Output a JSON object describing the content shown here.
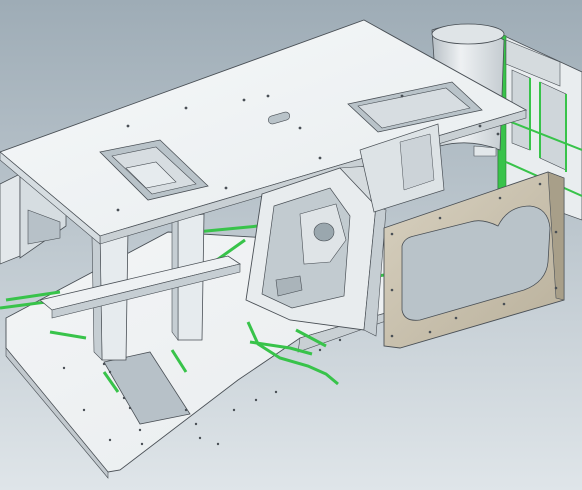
{
  "viewport": {
    "background_top": "#9fadb7",
    "background_bottom": "#d8dfe4"
  },
  "colors": {
    "sheet_metal": "#f2f4f5",
    "sheet_shadow": "#c9d0d4",
    "edge": "#4a5056",
    "accent_green": "#38c34a",
    "panel_tan": "#c8c0ad",
    "panel_tan_shadow": "#a89f89"
  },
  "parts": [
    "top-plate",
    "base-plate",
    "left-side-panel",
    "center-bracket-frame",
    "tan-side-panel",
    "rear-cylinder",
    "rear-green-frame"
  ]
}
